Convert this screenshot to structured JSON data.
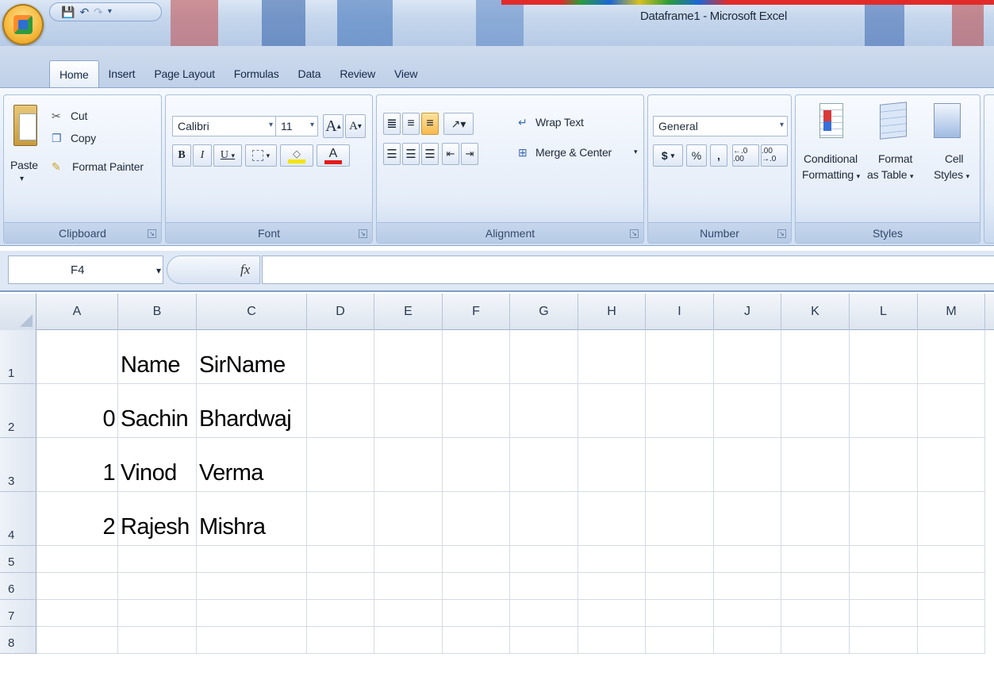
{
  "window": {
    "title": "Dataframe1 - Microsoft Excel",
    "qat_icons": [
      "save-icon",
      "undo-icon",
      "redo-icon",
      "customize-icon"
    ]
  },
  "tabs": [
    "Home",
    "Insert",
    "Page Layout",
    "Formulas",
    "Data",
    "Review",
    "View"
  ],
  "active_tab": "Home",
  "ribbon": {
    "clipboard": {
      "label": "Clipboard",
      "paste": "Paste",
      "cut": "Cut",
      "copy": "Copy",
      "format_painter": "Format Painter"
    },
    "font": {
      "label": "Font",
      "font_name": "Calibri",
      "font_size": "11",
      "bold": "B",
      "italic": "I",
      "underline": "U",
      "grow": "A",
      "shrink": "A",
      "font_color_letter": "A"
    },
    "alignment": {
      "label": "Alignment",
      "wrap_text": "Wrap Text",
      "merge_center": "Merge & Center"
    },
    "number": {
      "label": "Number",
      "format": "General",
      "currency": "$",
      "percent": "%",
      "comma": ",",
      "inc_decimal": "←.0 .00",
      "dec_decimal": ".00 →.0"
    },
    "styles": {
      "label": "Styles",
      "conditional_1": "Conditional",
      "conditional_2": "Formatting",
      "format_table_1": "Format",
      "format_table_2": "as Table",
      "cell_styles_1": "Cell",
      "cell_styles_2": "Styles"
    }
  },
  "formula_bar": {
    "name_box": "F4",
    "fx": "fx",
    "content": ""
  },
  "colors": {
    "highlight": "#f3e300",
    "font_color": "#e01b1b",
    "selected_align": "#f8c15a"
  },
  "grid": {
    "columns": [
      "A",
      "B",
      "C",
      "D",
      "E",
      "F",
      "G",
      "H",
      "I",
      "J",
      "K",
      "L",
      "M"
    ],
    "rows": [
      "1",
      "2",
      "3",
      "4",
      "5",
      "6",
      "7",
      "8"
    ],
    "cells": {
      "B1": "Name",
      "C1": "SirName",
      "A2": "0",
      "B2": "Sachin",
      "C2": "Bhardwaj",
      "A3": "1",
      "B3": "Vinod",
      "C3": "Verma",
      "A4": "2",
      "B4": "Rajesh",
      "C4": "Mishra"
    }
  }
}
